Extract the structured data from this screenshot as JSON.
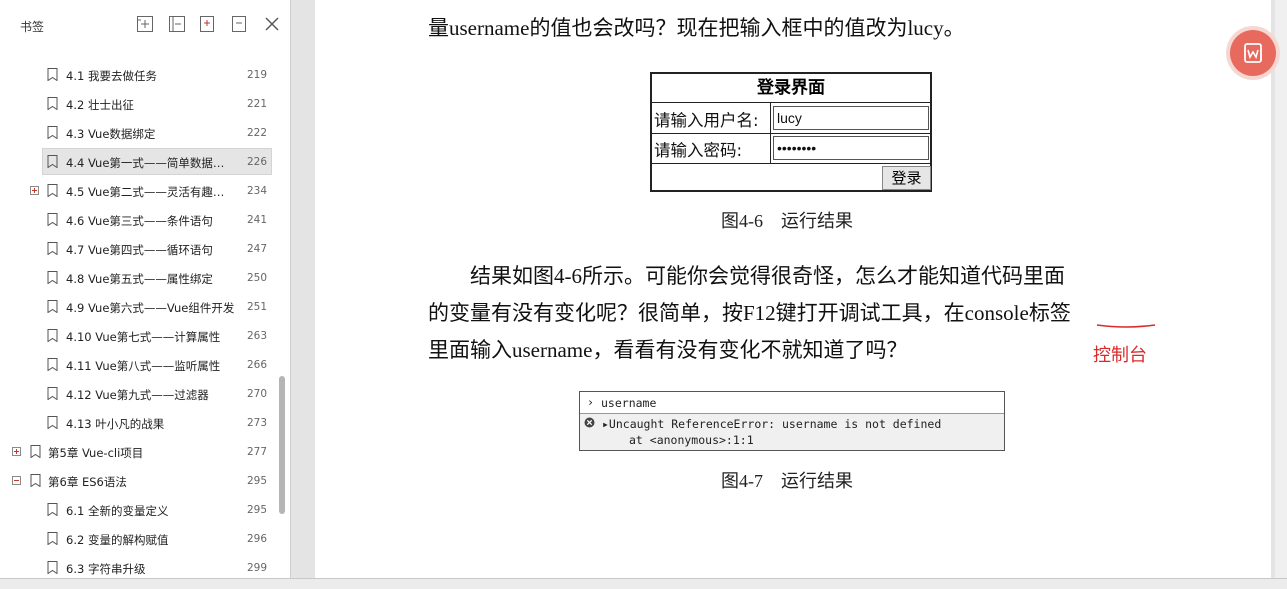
{
  "sidebar": {
    "title": "书签",
    "tools": [
      "add-bookmark-icon",
      "expand-bookmark-icon",
      "bookmark-icon",
      "collapse-bookmark-icon",
      "close-icon"
    ],
    "items": [
      {
        "label": "4.1  我要去做任务",
        "page": "219",
        "level": 2,
        "expand": "",
        "selected": false
      },
      {
        "label": "4.2  壮士出征",
        "page": "221",
        "level": 2,
        "expand": "",
        "selected": false
      },
      {
        "label": "4.3  Vue数据绑定",
        "page": "222",
        "level": 2,
        "expand": "",
        "selected": false
      },
      {
        "label": "4.4  Vue第一式——简单数据…",
        "page": "226",
        "level": 2,
        "expand": "",
        "selected": true
      },
      {
        "label": "4.5  Vue第二式——灵活有趣…",
        "page": "234",
        "level": 2,
        "expand": "plus",
        "selected": false
      },
      {
        "label": "4.6  Vue第三式——条件语句",
        "page": "241",
        "level": 2,
        "expand": "",
        "selected": false
      },
      {
        "label": "4.7  Vue第四式——循环语句",
        "page": "247",
        "level": 2,
        "expand": "",
        "selected": false
      },
      {
        "label": "4.8  Vue第五式——属性绑定",
        "page": "250",
        "level": 2,
        "expand": "",
        "selected": false
      },
      {
        "label": "4.9  Vue第六式——Vue组件开发",
        "page": "251",
        "level": 2,
        "expand": "",
        "selected": false
      },
      {
        "label": "4.10  Vue第七式——计算属性",
        "page": "263",
        "level": 2,
        "expand": "",
        "selected": false
      },
      {
        "label": "4.11  Vue第八式——监听属性",
        "page": "266",
        "level": 2,
        "expand": "",
        "selected": false
      },
      {
        "label": "4.12  Vue第九式——过滤器",
        "page": "270",
        "level": 2,
        "expand": "",
        "selected": false
      },
      {
        "label": "4.13  叶小凡的战果",
        "page": "273",
        "level": 2,
        "expand": "",
        "selected": false
      },
      {
        "label": "第5章  Vue-cli项目",
        "page": "277",
        "level": 1,
        "expand": "plus",
        "selected": false
      },
      {
        "label": "第6章  ES6语法",
        "page": "295",
        "level": 1,
        "expand": "minus",
        "selected": false
      },
      {
        "label": "6.1  全新的变量定义",
        "page": "295",
        "level": 2,
        "expand": "",
        "selected": false
      },
      {
        "label": "6.2  变量的解构赋值",
        "page": "296",
        "level": 2,
        "expand": "",
        "selected": false
      },
      {
        "label": "6.3  字符串升级",
        "page": "299",
        "level": 2,
        "expand": "",
        "selected": false
      }
    ]
  },
  "document": {
    "para_top": "量username的值也会改吗？现在把输入框中的值改为lucy。",
    "login": {
      "title": "登录界面",
      "username_label": "请输入用户名:",
      "username_value": "lucy",
      "password_label": "请输入密码:",
      "password_value": "••••••••",
      "button": "登录"
    },
    "caption_1": "图4-6　运行结果",
    "para_lines": [
      "　　结果如图4-6所示。可能你会觉得很奇怪，怎么才能知道代码里面",
      "的变量有没有变化呢？很简单，按F12键打开调试工具，在console标签",
      "里面输入username，看看有没有变化不就知道了吗？"
    ],
    "annotation": "控制台",
    "console": {
      "prompt": "›",
      "input": "username",
      "error_line1": "▸Uncaught ReferenceError: username is not defined",
      "error_line2": "at <anonymous>:1:1"
    },
    "caption_2": "图4-7　运行结果"
  },
  "colors": {
    "accent_float": "#e8695e",
    "annotation": "#d92b2b"
  }
}
